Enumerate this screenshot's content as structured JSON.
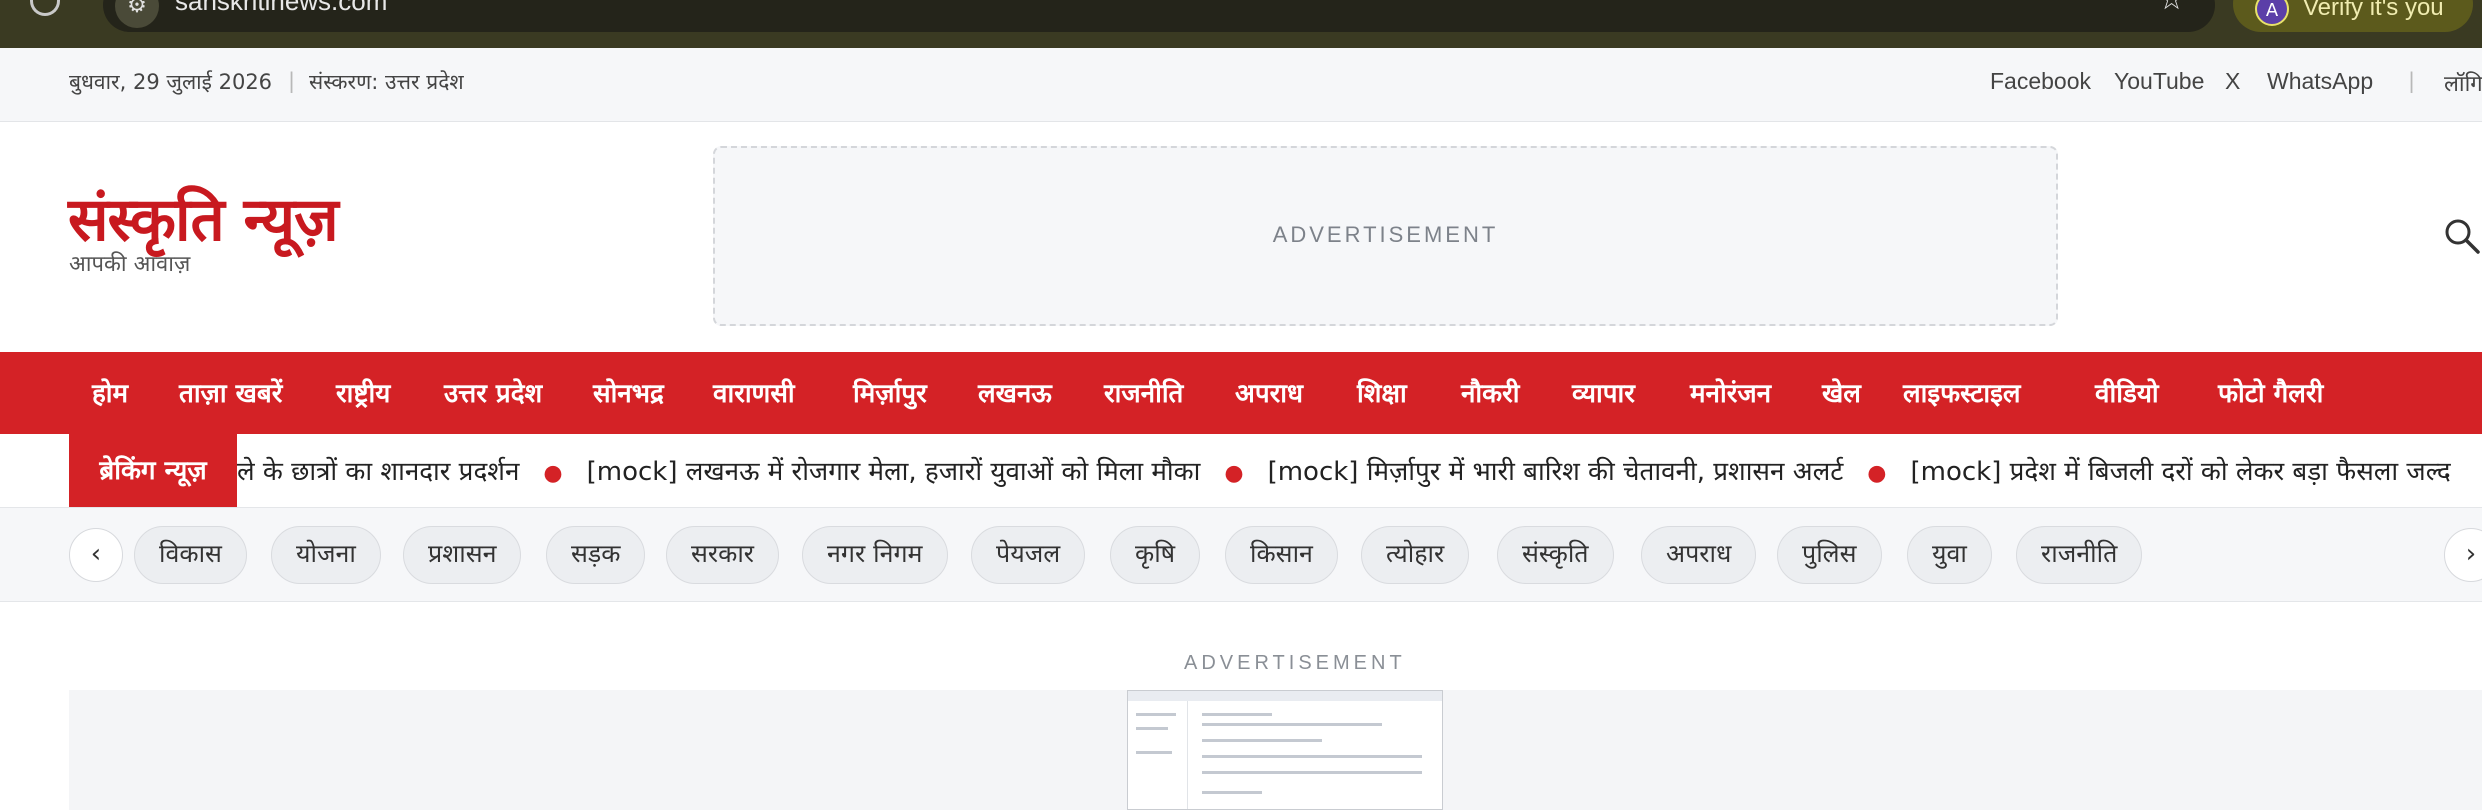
{
  "browser": {
    "url": "sanskritinews.com",
    "verify_label": "Verify it's you",
    "avatar_letter": "A"
  },
  "topbar": {
    "date": "बुधवार, 29 जुलाई 2026",
    "separator": "|",
    "edition": "संस्करण: उत्तर प्रदेश",
    "social": [
      "Facebook",
      "YouTube",
      "X",
      "WhatsApp"
    ],
    "login": "लॉगि"
  },
  "header": {
    "logo": "संस्कृति न्यूज़",
    "tagline": "आपकी आवाज़",
    "ad_label": "ADVERTISEMENT"
  },
  "nav": {
    "items": [
      "होम",
      "ताज़ा खबरें",
      "राष्ट्रीय",
      "उत्तर प्रदेश",
      "सोनभद्र",
      "वाराणसी",
      "मिर्ज़ापुर",
      "लखनऊ",
      "राजनीति",
      "अपराध",
      "शिक्षा",
      "नौकरी",
      "व्यापार",
      "मनोरंजन",
      "खेल",
      "लाइफस्टाइल",
      "वीडियो",
      "फोटो गैलरी"
    ]
  },
  "breaking": {
    "label": "ब्रेकिंग न्यूज़",
    "headlines": [
      "ले के छात्रों का शानदार प्रदर्शन",
      "[mock] लखनऊ में रोजगार मेला, हजारों युवाओं को मिला मौका",
      "[mock] मिर्ज़ापुर में भारी बारिश की चेतावनी, प्रशासन अलर्ट",
      "[mock] प्रदेश में बिजली दरों को लेकर बड़ा फैसला जल्द"
    ],
    "dot": "●"
  },
  "tags": {
    "prev": "‹",
    "next": "›",
    "items": [
      "विकास",
      "योजना",
      "प्रशासन",
      "सड़क",
      "सरकार",
      "नगर निगम",
      "पेयजल",
      "कृषि",
      "किसान",
      "त्योहार",
      "संस्कृति",
      "अपराध",
      "पुलिस",
      "युवा",
      "राजनीति"
    ]
  },
  "content": {
    "ad_label": "ADVERTISEMENT"
  },
  "colors": {
    "brand_red": "#d42226",
    "chrome_bg": "#3a3a22"
  }
}
